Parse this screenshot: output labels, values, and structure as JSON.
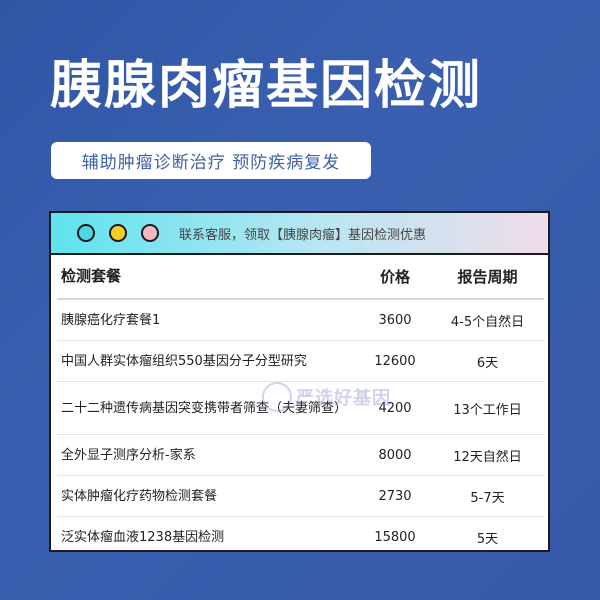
{
  "hero": {
    "title": "胰腺肉瘤基因检测",
    "subtitle": "辅助肿瘤诊断治疗 预防疾病复发"
  },
  "card": {
    "header_text": "联系客服，领取【胰腺肉瘤】基因检测优惠",
    "dots": [
      "teal",
      "yellow",
      "pink"
    ],
    "columns": [
      "检测套餐",
      "价格",
      "报告周期"
    ],
    "rows": [
      {
        "name": "胰腺癌化疗套餐1",
        "price": "3600",
        "period": "4-5个自然日"
      },
      {
        "name": "中国人群实体瘤组织550基因分子分型研究",
        "price": "12600",
        "period": "6天"
      },
      {
        "name": "二十二种遗传病基因突变携带者筛查（夫妻筛查）",
        "price": "4200",
        "period": "13个工作日"
      },
      {
        "name": "全外显子测序分析-家系",
        "price": "8000",
        "period": "12天自然日"
      },
      {
        "name": "实体肿瘤化疗药物检测套餐",
        "price": "2730",
        "period": "5-7天"
      },
      {
        "name": "泛实体瘤血液1238基因检测",
        "price": "15800",
        "period": "5天"
      }
    ]
  },
  "watermark": {
    "text": "严选好基因"
  },
  "colors": {
    "background": "#3659a8",
    "accent_text": "#3f62a8",
    "dot_teal": "#4fd6e0",
    "dot_yellow": "#f6cd27",
    "dot_pink": "#f4b8bd"
  }
}
